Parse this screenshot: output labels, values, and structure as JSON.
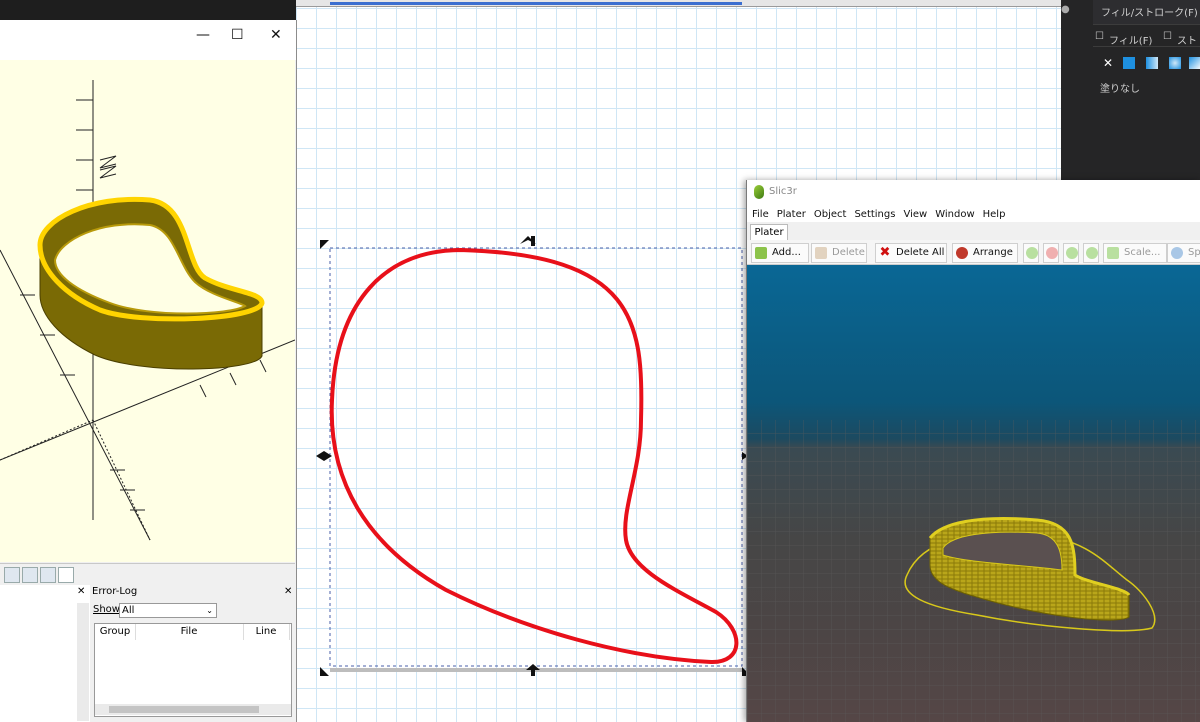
{
  "scad": {
    "window_controls": {
      "minimize": "—",
      "maximize": "☐",
      "close": "✕"
    },
    "console_close": "✕",
    "error_log": {
      "title": "Error-Log",
      "close": "✕",
      "show_label": "Show",
      "show_value": "All",
      "columns": [
        "Group",
        "File",
        "Line"
      ]
    }
  },
  "slicer": {
    "title": "Slic3r",
    "menu": [
      "File",
      "Plater",
      "Object",
      "Settings",
      "View",
      "Window",
      "Help"
    ],
    "tab": "Plater",
    "toolbar": {
      "add": "Add...",
      "delete": "Delete",
      "delete_all": "Delete All",
      "arrange": "Arrange",
      "scale": "Scale...",
      "split": "Sp"
    }
  },
  "panel": {
    "tab_fill_stroke": "フィル/ストローク(F)",
    "tab_more": "スト",
    "subtab_fill": "フィル(F)",
    "subtab_stroke": "スト",
    "no_fill_x": "✕",
    "no_fill_label": "塗りなし"
  },
  "colors": {
    "path_red": "#e8101a",
    "model_yellow": "#c9ae12",
    "accent_blue": "#1e90e0"
  }
}
